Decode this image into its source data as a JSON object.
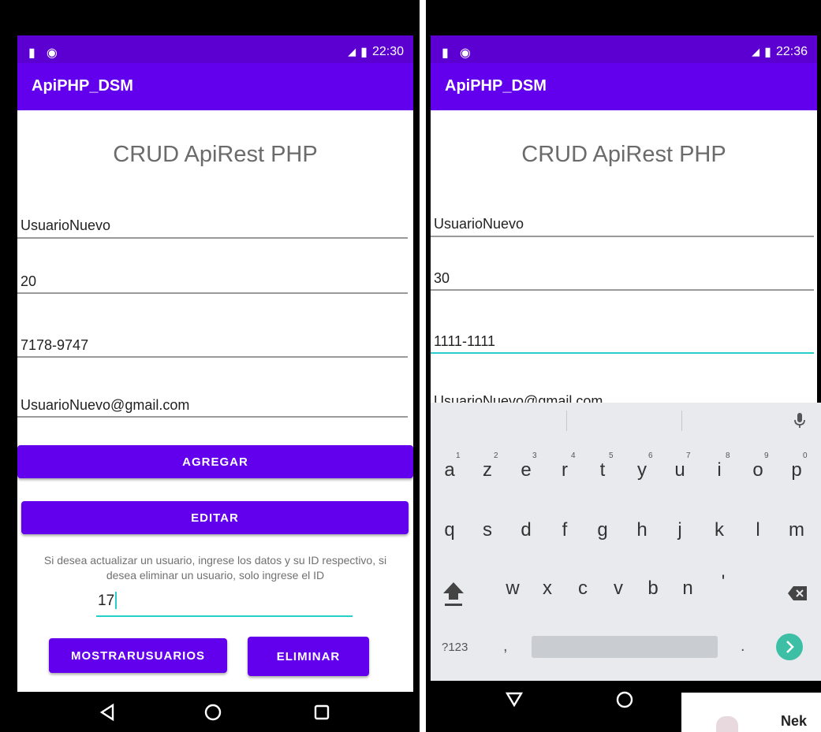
{
  "left": {
    "status": {
      "time": "22:30"
    },
    "app_title": "ApiPHP_DSM",
    "heading": "CRUD ApiRest PHP",
    "fields": {
      "name": "UsuarioNuevo",
      "age": "20",
      "phone": "7178-9747",
      "email": "UsuarioNuevo@gmail.com"
    },
    "buttons": {
      "add": "AGREGAR",
      "edit": "EDITAR",
      "show": "MOSTRARUSUARIOS",
      "delete": "ELIMINAR"
    },
    "helper_text": "Si desea actualizar un usuario, ingrese los datos y su ID respectivo, si desea eliminar un usuario, solo ingrese el ID",
    "id_value": "17"
  },
  "right": {
    "status": {
      "time": "22:36"
    },
    "app_title": "ApiPHP_DSM",
    "heading": "CRUD ApiRest PHP",
    "fields": {
      "name": "UsuarioNuevo",
      "age": "30",
      "phone": "1111-1111",
      "email": "UsuarioNuevo@gmail.com"
    },
    "keyboard": {
      "row1": [
        {
          "k": "a",
          "n": "1"
        },
        {
          "k": "z",
          "n": "2"
        },
        {
          "k": "e",
          "n": "3"
        },
        {
          "k": "r",
          "n": "4"
        },
        {
          "k": "t",
          "n": "5"
        },
        {
          "k": "y",
          "n": "6"
        },
        {
          "k": "u",
          "n": "7"
        },
        {
          "k": "i",
          "n": "8"
        },
        {
          "k": "o",
          "n": "9"
        },
        {
          "k": "p",
          "n": "0"
        }
      ],
      "row2": [
        "q",
        "s",
        "d",
        "f",
        "g",
        "h",
        "j",
        "k",
        "l",
        "m"
      ],
      "row3": [
        "w",
        "x",
        "c",
        "v",
        "b",
        "n",
        "'"
      ],
      "symbols_key": "?123",
      "comma": ",",
      "period": "."
    },
    "toast_text": "Nek"
  },
  "colors": {
    "primary": "#6200ee",
    "status": "#5c00d2",
    "accent": "#25d0c8",
    "keyboard_bg": "#e8eaed"
  }
}
